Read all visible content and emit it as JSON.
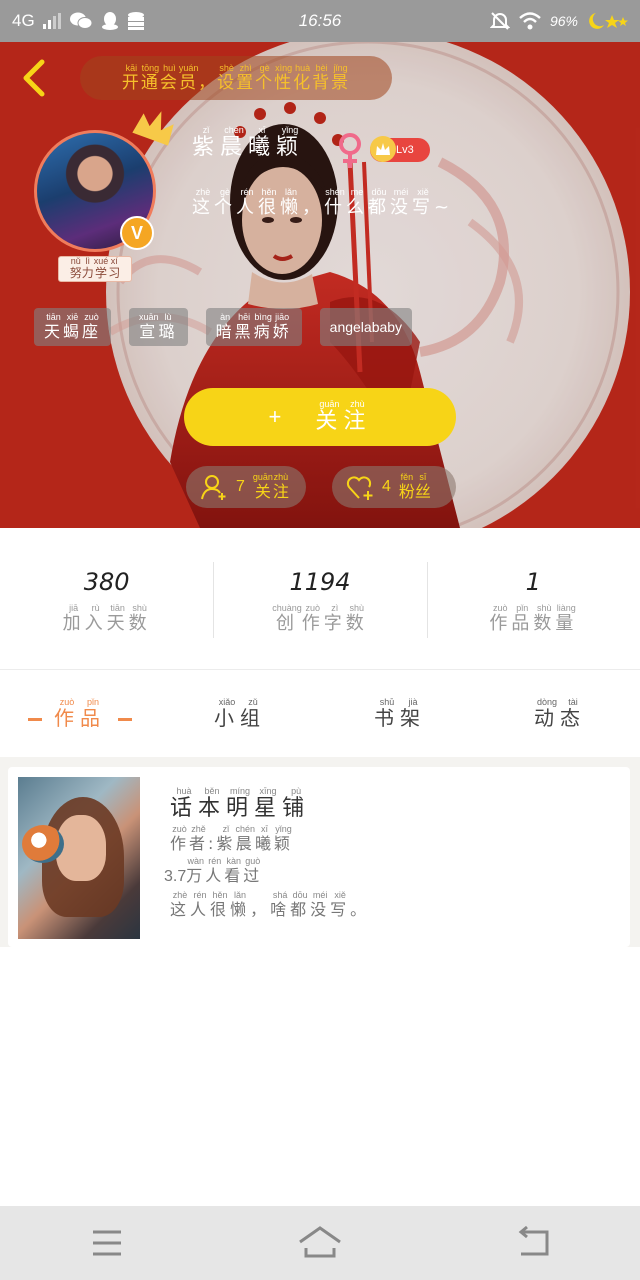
{
  "status_bar": {
    "network": "4G",
    "time": "16:56",
    "battery": "96%"
  },
  "banner": {
    "text": "开通会员，设置个性化背景",
    "pinyin": [
      "kāi",
      "tōng",
      "huì",
      "yuán",
      "",
      "shè",
      "zhì",
      "gè",
      "xìng",
      "huà",
      "bèi",
      "jǐng"
    ]
  },
  "profile": {
    "username": "紫晨曦颖",
    "username_pinyin": [
      "zǐ",
      "chén",
      "xī",
      "yǐng"
    ],
    "level": "Lv3",
    "bio": "这个人很懒，什么都没写~",
    "bio_pinyin": [
      "zhè",
      "gè",
      "rén",
      "hěn",
      "lǎn",
      "",
      "shén",
      "me",
      "dōu",
      "méi",
      "xiě",
      ""
    ],
    "title_tag": "努力学习",
    "title_tag_pinyin": [
      "nǔ",
      "lì",
      "xué",
      "xí"
    ],
    "verified_badge": "V",
    "tags": [
      {
        "text": "天蝎座",
        "pinyin": [
          "tiān",
          "xiē",
          "zuò"
        ]
      },
      {
        "text": "宣璐",
        "pinyin": [
          "xuān",
          "lù"
        ]
      },
      {
        "text": "暗黑病娇",
        "pinyin": [
          "àn",
          "hēi",
          "bìng",
          "jiāo"
        ]
      },
      {
        "text": "angelababy",
        "pinyin": []
      }
    ]
  },
  "follow_button": {
    "icon": "+",
    "text": "关注",
    "pinyin": [
      "guān",
      "zhù"
    ]
  },
  "following": {
    "count": "7",
    "label": "关注",
    "pinyin": [
      "guān",
      "zhù"
    ]
  },
  "fans": {
    "count": "4",
    "label": "粉丝",
    "pinyin": [
      "fěn",
      "sī"
    ]
  },
  "stats": [
    {
      "value": "380",
      "label": "加入天数",
      "pinyin": [
        "jiā",
        "rù",
        "tiān",
        "shù"
      ]
    },
    {
      "value": "1194",
      "label": "创作字数",
      "pinyin": [
        "chuàng",
        "zuò",
        "zì",
        "shù"
      ]
    },
    {
      "value": "1",
      "label": "作品数量",
      "pinyin": [
        "zuò",
        "pǐn",
        "shù",
        "liàng"
      ]
    }
  ],
  "tabs": [
    {
      "label": "作品",
      "pinyin": [
        "zuò",
        "pǐn"
      ],
      "active": true
    },
    {
      "label": "小组",
      "pinyin": [
        "xiǎo",
        "zǔ"
      ],
      "active": false
    },
    {
      "label": "书架",
      "pinyin": [
        "shū",
        "jià"
      ],
      "active": false
    },
    {
      "label": "动态",
      "pinyin": [
        "dòng",
        "tài"
      ],
      "active": false
    }
  ],
  "works": [
    {
      "title": "话本明星铺",
      "title_pinyin": [
        "huà",
        "běn",
        "míng",
        "xīng",
        "pù"
      ],
      "author_prefix": "作者:",
      "author_prefix_pinyin": [
        "zuò",
        "zhě",
        ""
      ],
      "author": "紫晨曦颖",
      "author_pinyin": [
        "zǐ",
        "chén",
        "xī",
        "yǐng"
      ],
      "views_num": "3.7",
      "views_text": "万人看过",
      "views_pinyin": [
        "wàn",
        "rén",
        "kàn",
        "guò"
      ],
      "desc": "这人很懒，啥都没写。",
      "desc_pinyin": [
        "zhè",
        "rén",
        "hěn",
        "lǎn",
        "",
        "shá",
        "dōu",
        "méi",
        "xiě",
        ""
      ]
    }
  ],
  "icons": {
    "back": "chevron-left-icon",
    "crown": "crown-icon",
    "gender": "female-icon",
    "following": "person-plus-icon",
    "fans": "heart-plus-icon",
    "nav_menu": "menu-icon",
    "nav_home": "home-icon",
    "nav_back": "back-icon"
  },
  "colors": {
    "accent_yellow": "#f7d417",
    "accent_orange": "#f08a4b",
    "hero_red": "#c0281a",
    "level_red": "#e8453f",
    "gender_pink": "#f06a8a"
  }
}
